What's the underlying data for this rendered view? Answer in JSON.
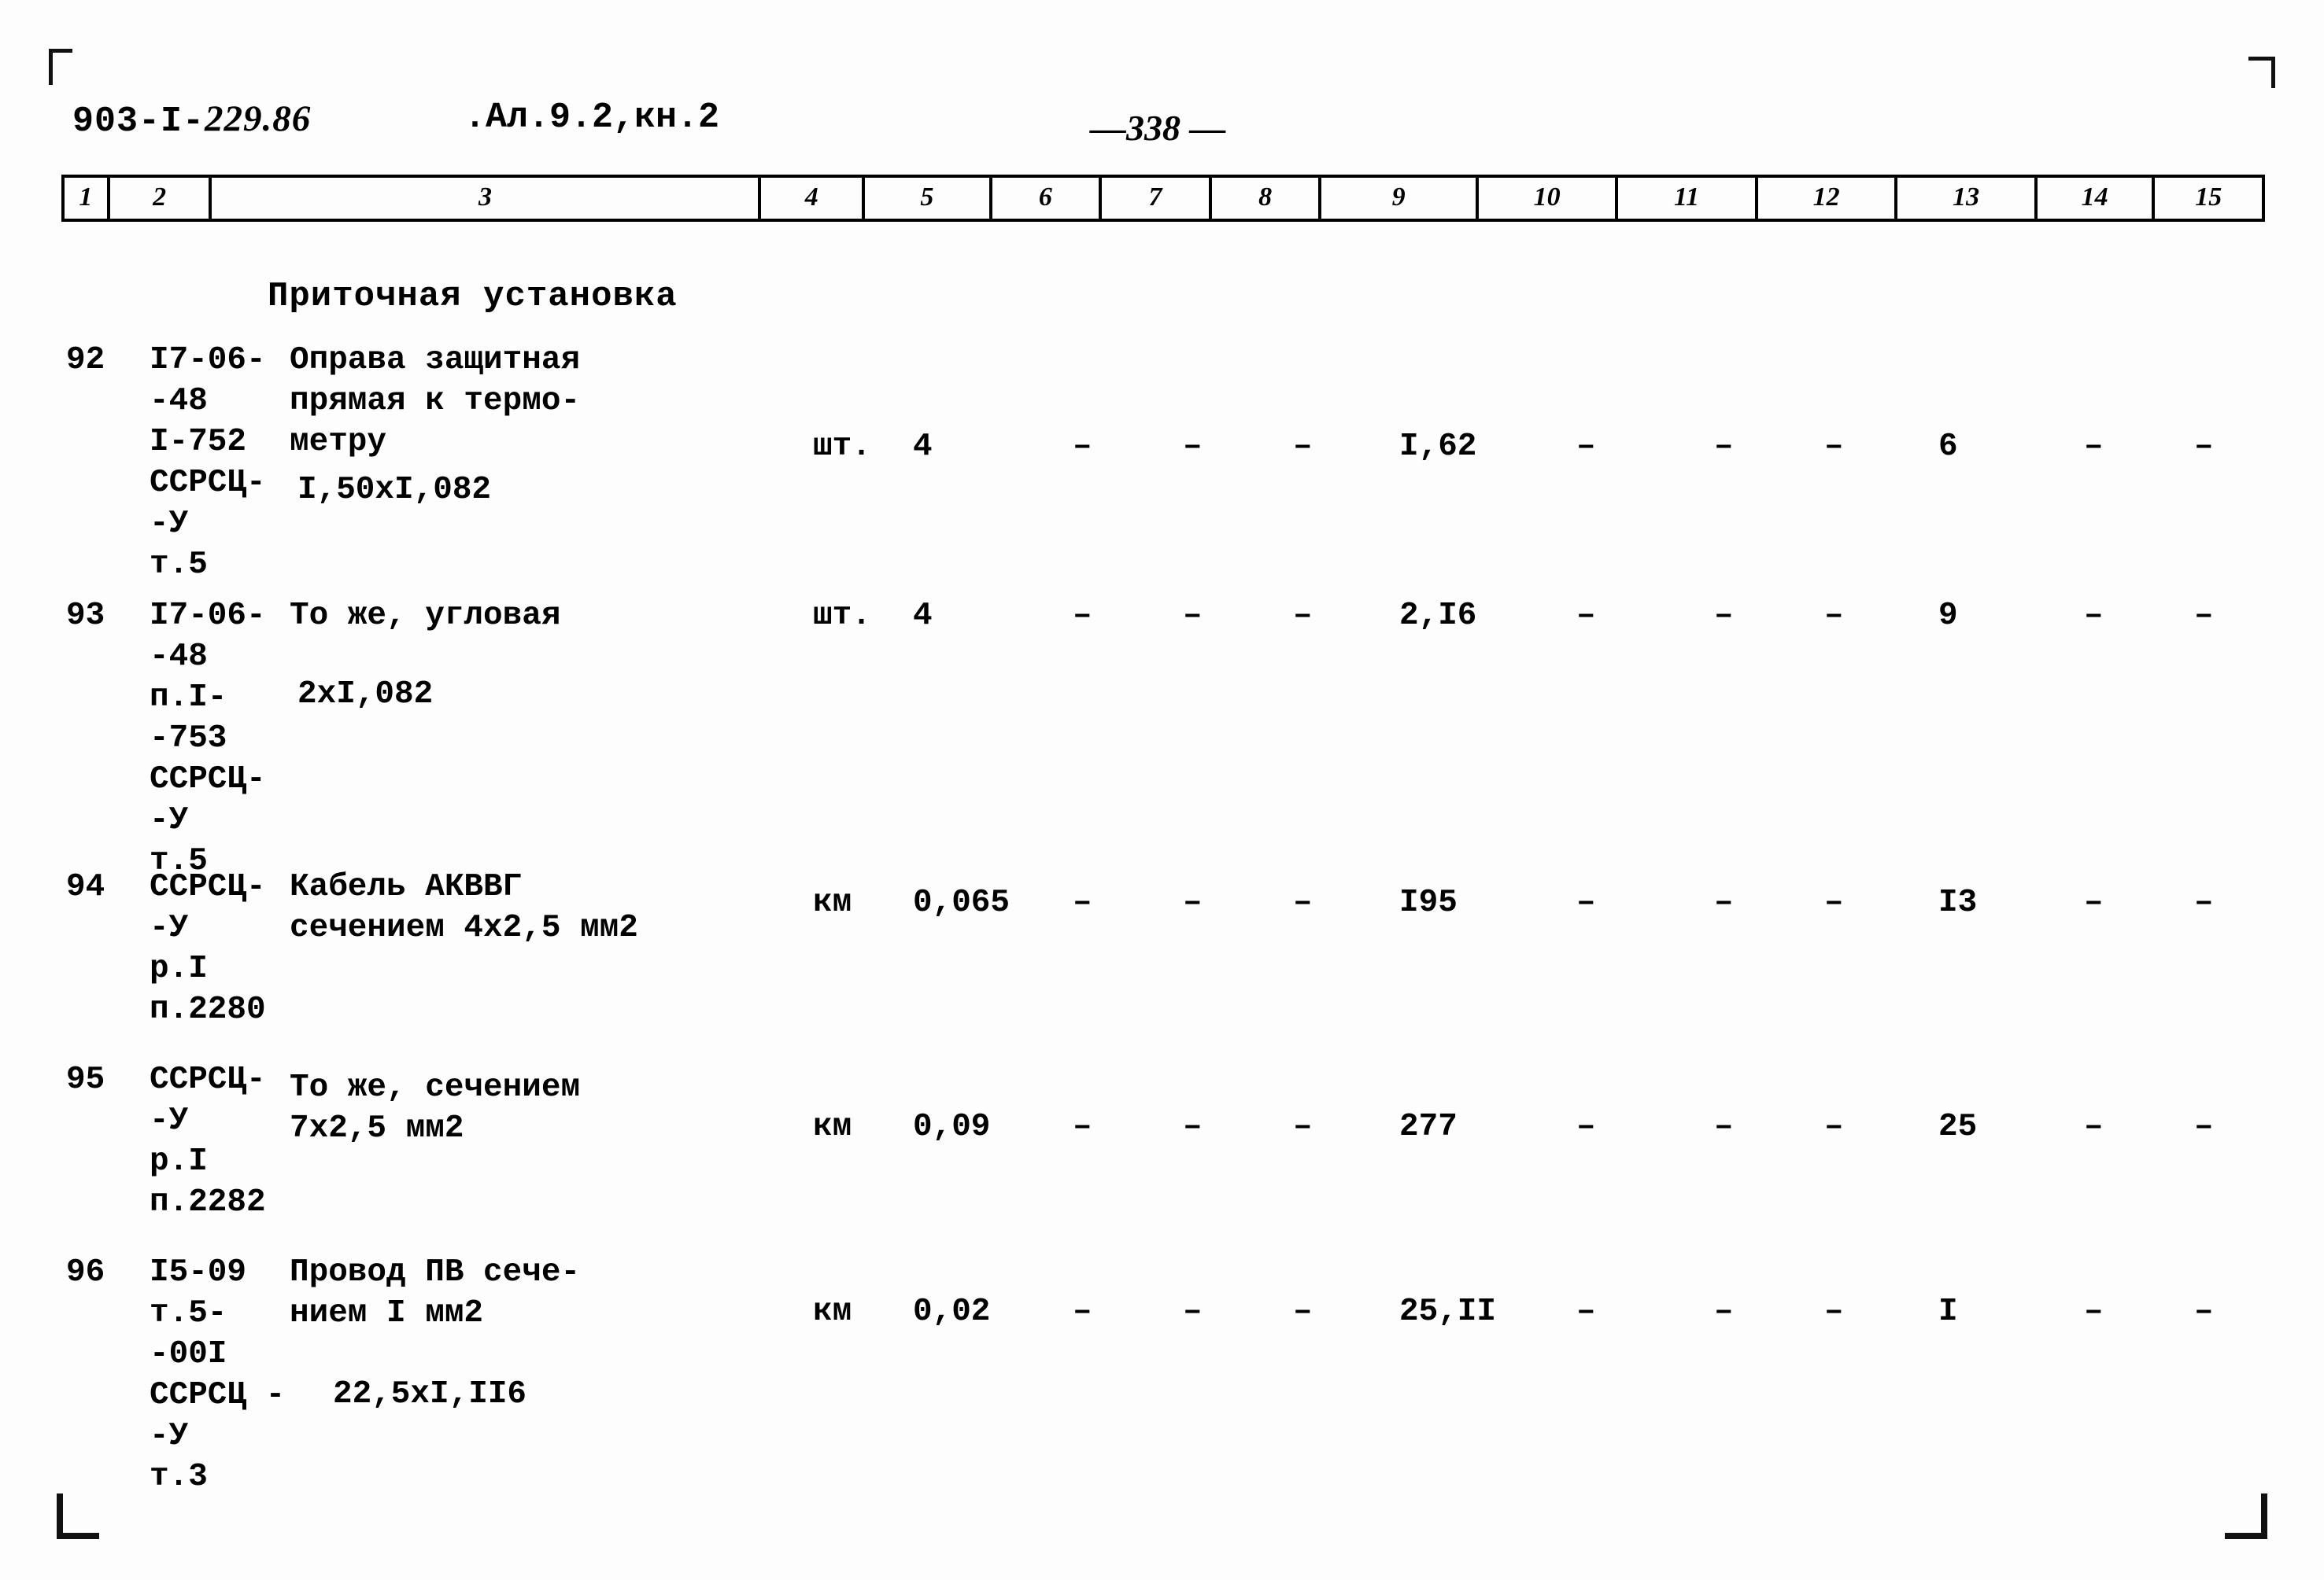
{
  "document": {
    "code_prefix": "903-I-",
    "code_suffix": "229.86",
    "album": ".Ал.9.2,кн.2",
    "page_number": "—338 —"
  },
  "column_headers": [
    "1",
    "2",
    "3",
    "4",
    "5",
    "6",
    "7",
    "8",
    "9",
    "10",
    "11",
    "12",
    "13",
    "14",
    "15"
  ],
  "section_title": "Приточная установка",
  "rows": [
    {
      "num": "92",
      "code": "I7-06-\n-48\nI-752\nССРСЦ-\n-У\nт.5",
      "desc": "Оправа защитная\nпрямая к термо-\nметру",
      "desc_extra": "I,50хI,082",
      "unit": "шт.",
      "qty": "4",
      "c6": "–",
      "c7": "–",
      "c8": "–",
      "c9": "I,62",
      "c10": "–",
      "c11": "–",
      "c12": "–",
      "c13": "6",
      "c14": "–",
      "c15": "–"
    },
    {
      "num": "93",
      "code": "I7-06-\n-48\nп.I-\n-753\nССРСЦ-\n-У\nт.5",
      "desc": "То же, угловая",
      "desc_extra": "2хI,082",
      "unit": "шт.",
      "qty": "4",
      "c6": "–",
      "c7": "–",
      "c8": "–",
      "c9": "2,I6",
      "c10": "–",
      "c11": "–",
      "c12": "–",
      "c13": "9",
      "c14": "–",
      "c15": "–"
    },
    {
      "num": "94",
      "code": "ССРСЦ-\n-У\nр.I\nп.2280",
      "desc": "Кабель АКВВГ\nсечением 4х2,5 мм2",
      "desc_extra": "",
      "unit": "км",
      "qty": "0,065",
      "c6": "–",
      "c7": "–",
      "c8": "–",
      "c9": "I95",
      "c10": "–",
      "c11": "–",
      "c12": "–",
      "c13": "I3",
      "c14": "–",
      "c15": "–"
    },
    {
      "num": "95",
      "code": "ССРСЦ-\n-У\nр.I\nп.2282",
      "desc": "То же, сечением\n7х2,5 мм2",
      "desc_extra": "",
      "unit": "км",
      "qty": "0,09",
      "c6": "–",
      "c7": "–",
      "c8": "–",
      "c9": "277",
      "c10": "–",
      "c11": "–",
      "c12": "–",
      "c13": "25",
      "c14": "–",
      "c15": "–"
    },
    {
      "num": "96",
      "code": "I5-09\nт.5-\n-00I\nССРСЦ -\n-У\nт.3",
      "desc": "Провод ПВ сече-\nнием I мм2",
      "desc_extra": "22,5хI,II6",
      "unit": "км",
      "qty": "0,02",
      "c6": "–",
      "c7": "–",
      "c8": "–",
      "c9": "25,II",
      "c10": "–",
      "c11": "–",
      "c12": "–",
      "c13": "I",
      "c14": "–",
      "c15": "–"
    }
  ]
}
